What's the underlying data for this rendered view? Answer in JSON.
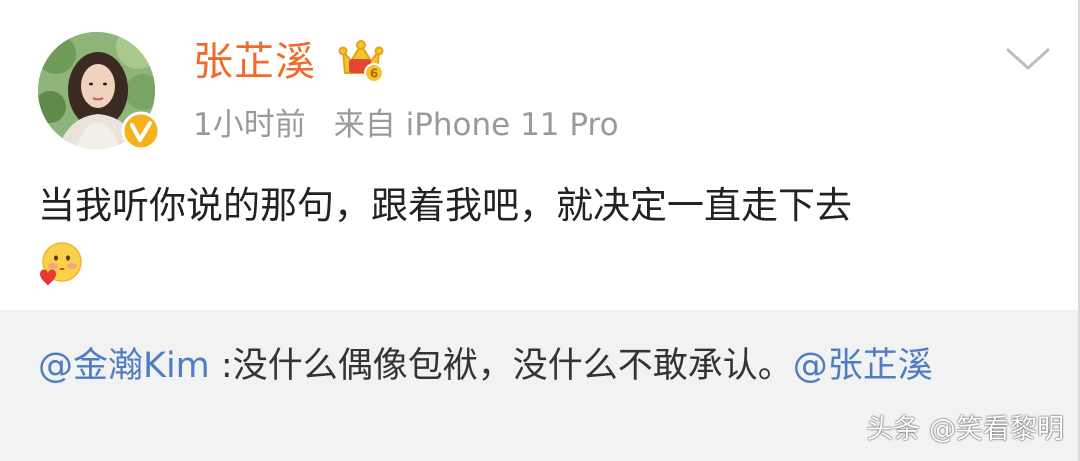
{
  "post": {
    "author_name": "张芷溪",
    "avatar_icon": "user-avatar",
    "verified_icon": "verified-v-icon",
    "member_icon": "crown-member-icon",
    "member_level": "6",
    "menu_icon": "chevron-down-icon",
    "time": "1小时前",
    "source": "来自 iPhone 11 Pro",
    "text": "当我听你说的那句，跟着我吧，就决定一直走下去",
    "emoji_icon": "shy-kiss-emoji-icon"
  },
  "repost": {
    "mention_user": "@金瀚Kim",
    "text": " :没什么偶像包袱，没什么不敢承认。",
    "mention_tail": "@张芷溪"
  },
  "watermark": "头条 @笑看黎明",
  "colors": {
    "author": "#f06b2a",
    "mention": "#4e7dc2",
    "meta": "#9a9a9a",
    "repost_bg": "#f2f2f2",
    "verified": "#f5b21b"
  }
}
